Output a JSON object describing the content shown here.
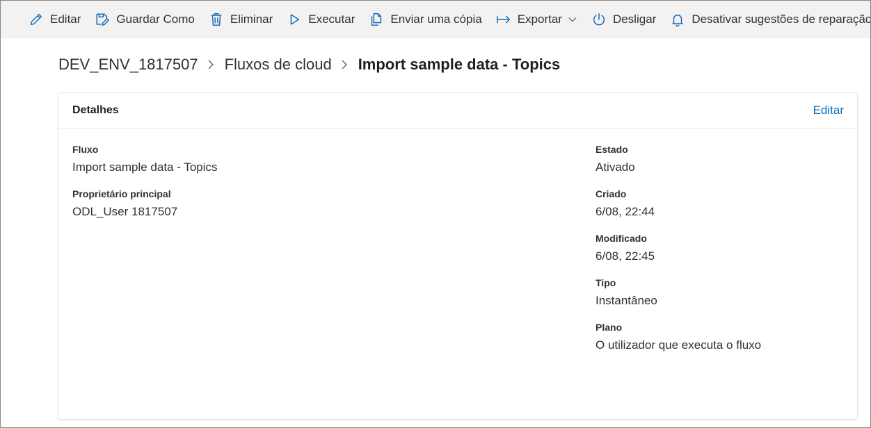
{
  "toolbar": {
    "edit_label": "Editar",
    "save_as_label": "Guardar Como",
    "delete_label": "Eliminar",
    "run_label": "Executar",
    "send_copy_label": "Enviar uma cópia",
    "export_label": "Exportar",
    "turn_off_label": "Desligar",
    "disable_suggestions_label": "Desativar sugestões de reparação"
  },
  "breadcrumb": {
    "environment": "DEV_ENV_1817507",
    "section": "Fluxos de cloud",
    "current": "Import sample data - Topics"
  },
  "details": {
    "title": "Detalhes",
    "edit_link": "Editar",
    "left_fields": [
      {
        "label": "Fluxo",
        "value": "Import sample data - Topics"
      },
      {
        "label": "Proprietário principal",
        "value": "ODL_User 1817507"
      }
    ],
    "right_fields": [
      {
        "label": "Estado",
        "value": "Ativado"
      },
      {
        "label": "Criado",
        "value": "6/08, 22:44"
      },
      {
        "label": "Modificado",
        "value": "6/08, 22:45"
      },
      {
        "label": "Tipo",
        "value": "Instantâneo"
      },
      {
        "label": "Plano",
        "value": "O utilizador que executa o fluxo"
      }
    ]
  },
  "colors": {
    "accent": "#0f6cbd",
    "toolbar_bg": "#f3f2f1",
    "text": "#323130"
  },
  "icons": {
    "edit": "pencil-icon",
    "save_as": "save-as-icon",
    "delete": "trash-icon",
    "run": "play-icon",
    "send_copy": "copy-icon",
    "export": "export-arrow-icon",
    "turn_off": "power-icon",
    "disable_suggestions": "bell-icon"
  }
}
